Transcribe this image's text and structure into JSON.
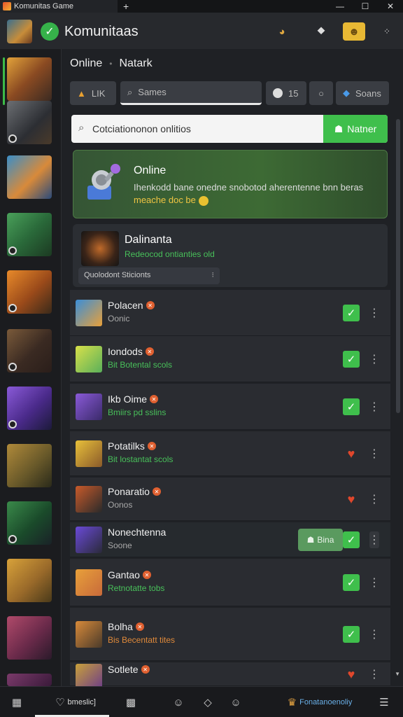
{
  "window": {
    "tab_title": "Komunitas Game",
    "new_tab": "+",
    "minimize": "—",
    "maximize": "☐",
    "close": "✕"
  },
  "header": {
    "title": "Komunitaas"
  },
  "breadcrumb": {
    "first": "Online",
    "separator": "•",
    "second": "Natark"
  },
  "toolbar": {
    "btn1_label": "LIK",
    "btn2_label": "Sames",
    "btn3_label": "15",
    "btn5_label": "Soans"
  },
  "search": {
    "value": "Cotciationonon onlitios",
    "button_label": "Natner"
  },
  "banner": {
    "title": "Online",
    "text": "Ihenkodd bane onedne snobotod aherentenne bnn beras",
    "highlight": "meache doc be"
  },
  "profile": {
    "name": "Dalinanta",
    "subtitle": "Redeocod ontianties old",
    "dropdown": "Quolodont Sticionts"
  },
  "friends": [
    {
      "name": "Polacen",
      "status": "Oonic",
      "status_color": "#a9a9a9",
      "action": "check"
    },
    {
      "name": "Iondods",
      "status": "Bit Botental scols",
      "status_color": "#48c05a",
      "action": "check"
    },
    {
      "name": "Ikb Oime",
      "status": "Bmiirs pd sslins",
      "status_color": "#48c05a",
      "action": "check"
    },
    {
      "name": "Potatilks",
      "status": "Bit lostantat scols",
      "status_color": "#48c05a",
      "action": "heart"
    },
    {
      "name": "Ponaratio",
      "status": "Oonos",
      "status_color": "#a9a9a9",
      "action": "heart"
    },
    {
      "name": "Nonechtenna",
      "status": "Soone",
      "status_color": "#a9a9a9",
      "action": "check",
      "pill": "Bina"
    },
    {
      "name": "Gantao",
      "status": "Retnotatte tobs",
      "status_color": "#48c05a",
      "action": "check"
    },
    {
      "name": "Bolha",
      "status": "Bis Becentatt tites",
      "status_color": "#e08a3a",
      "action": "check"
    },
    {
      "name": "Sotlete",
      "status": "",
      "status_color": "#a9a9a9",
      "action": "heart"
    }
  ],
  "bottombar": {
    "tab1_label": "bmeslic]",
    "tab_right_label": "Fonatanoenoliy"
  },
  "colors": {
    "accent": "#3fbf4c",
    "heart": "#e0472c",
    "background": "#1f2125"
  }
}
